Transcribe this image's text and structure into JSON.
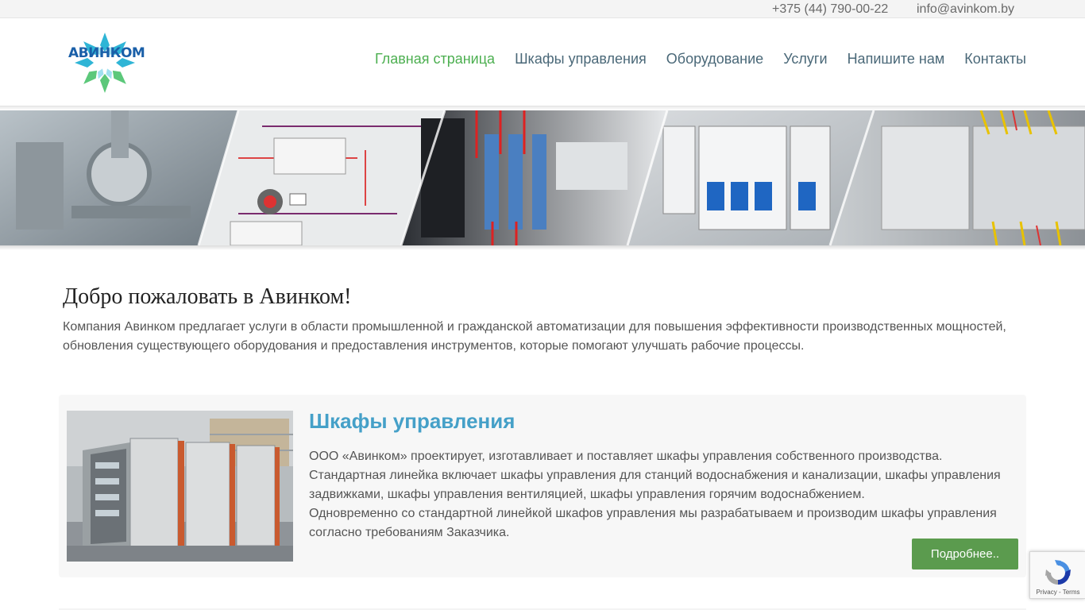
{
  "topbar": {
    "phone": "+375 (44) 790-00-22",
    "email": "info@avinkom.by"
  },
  "header": {
    "logo_text": "АВИНКОМ",
    "nav": [
      {
        "label": "Главная страница",
        "active": true
      },
      {
        "label": "Шкафы управления",
        "active": false
      },
      {
        "label": "Оборудование",
        "active": false
      },
      {
        "label": "Услуги",
        "active": false
      },
      {
        "label": "Напишите нам",
        "active": false
      },
      {
        "label": "Контакты",
        "active": false
      }
    ]
  },
  "welcome": {
    "title": "Добро пожаловать в Авинком!",
    "text": "Компания Авинком предлагает услуги в области промышленной и гражданской автоматизации для повышения эффективности производственных мощностей, обновления существующего оборудования и предоставления инструментов, которые помогают улучшать рабочие процессы."
  },
  "card": {
    "title": "Шкафы управления",
    "paragraphs": [
      "ООО «Авинком» проектирует, изготавливает и поставляет шкафы управления собственного производства.",
      "Стандартная линейка включает шкафы управления для станций водоснабжения и канализации, шкафы управления задвижками, шкафы управления вентиляцией, шкафы управления горячим водоснабжением.",
      "Одновременно со стандартной линейкой шкафов управления мы разрабатываем и производим шкафы управления согласно требованиям Заказчика."
    ],
    "button_label": "Подробнее.."
  },
  "recaptcha": {
    "privacy": "Privacy",
    "separator": " - ",
    "terms": "Terms"
  },
  "colors": {
    "nav_active": "#4caf50",
    "nav_default": "#4a6878",
    "card_title": "#45a0c8",
    "button_bg": "#5b9b4e"
  },
  "icons": {
    "logo": "avinkom-snowflake-logo",
    "recaptcha": "recaptcha-icon"
  }
}
